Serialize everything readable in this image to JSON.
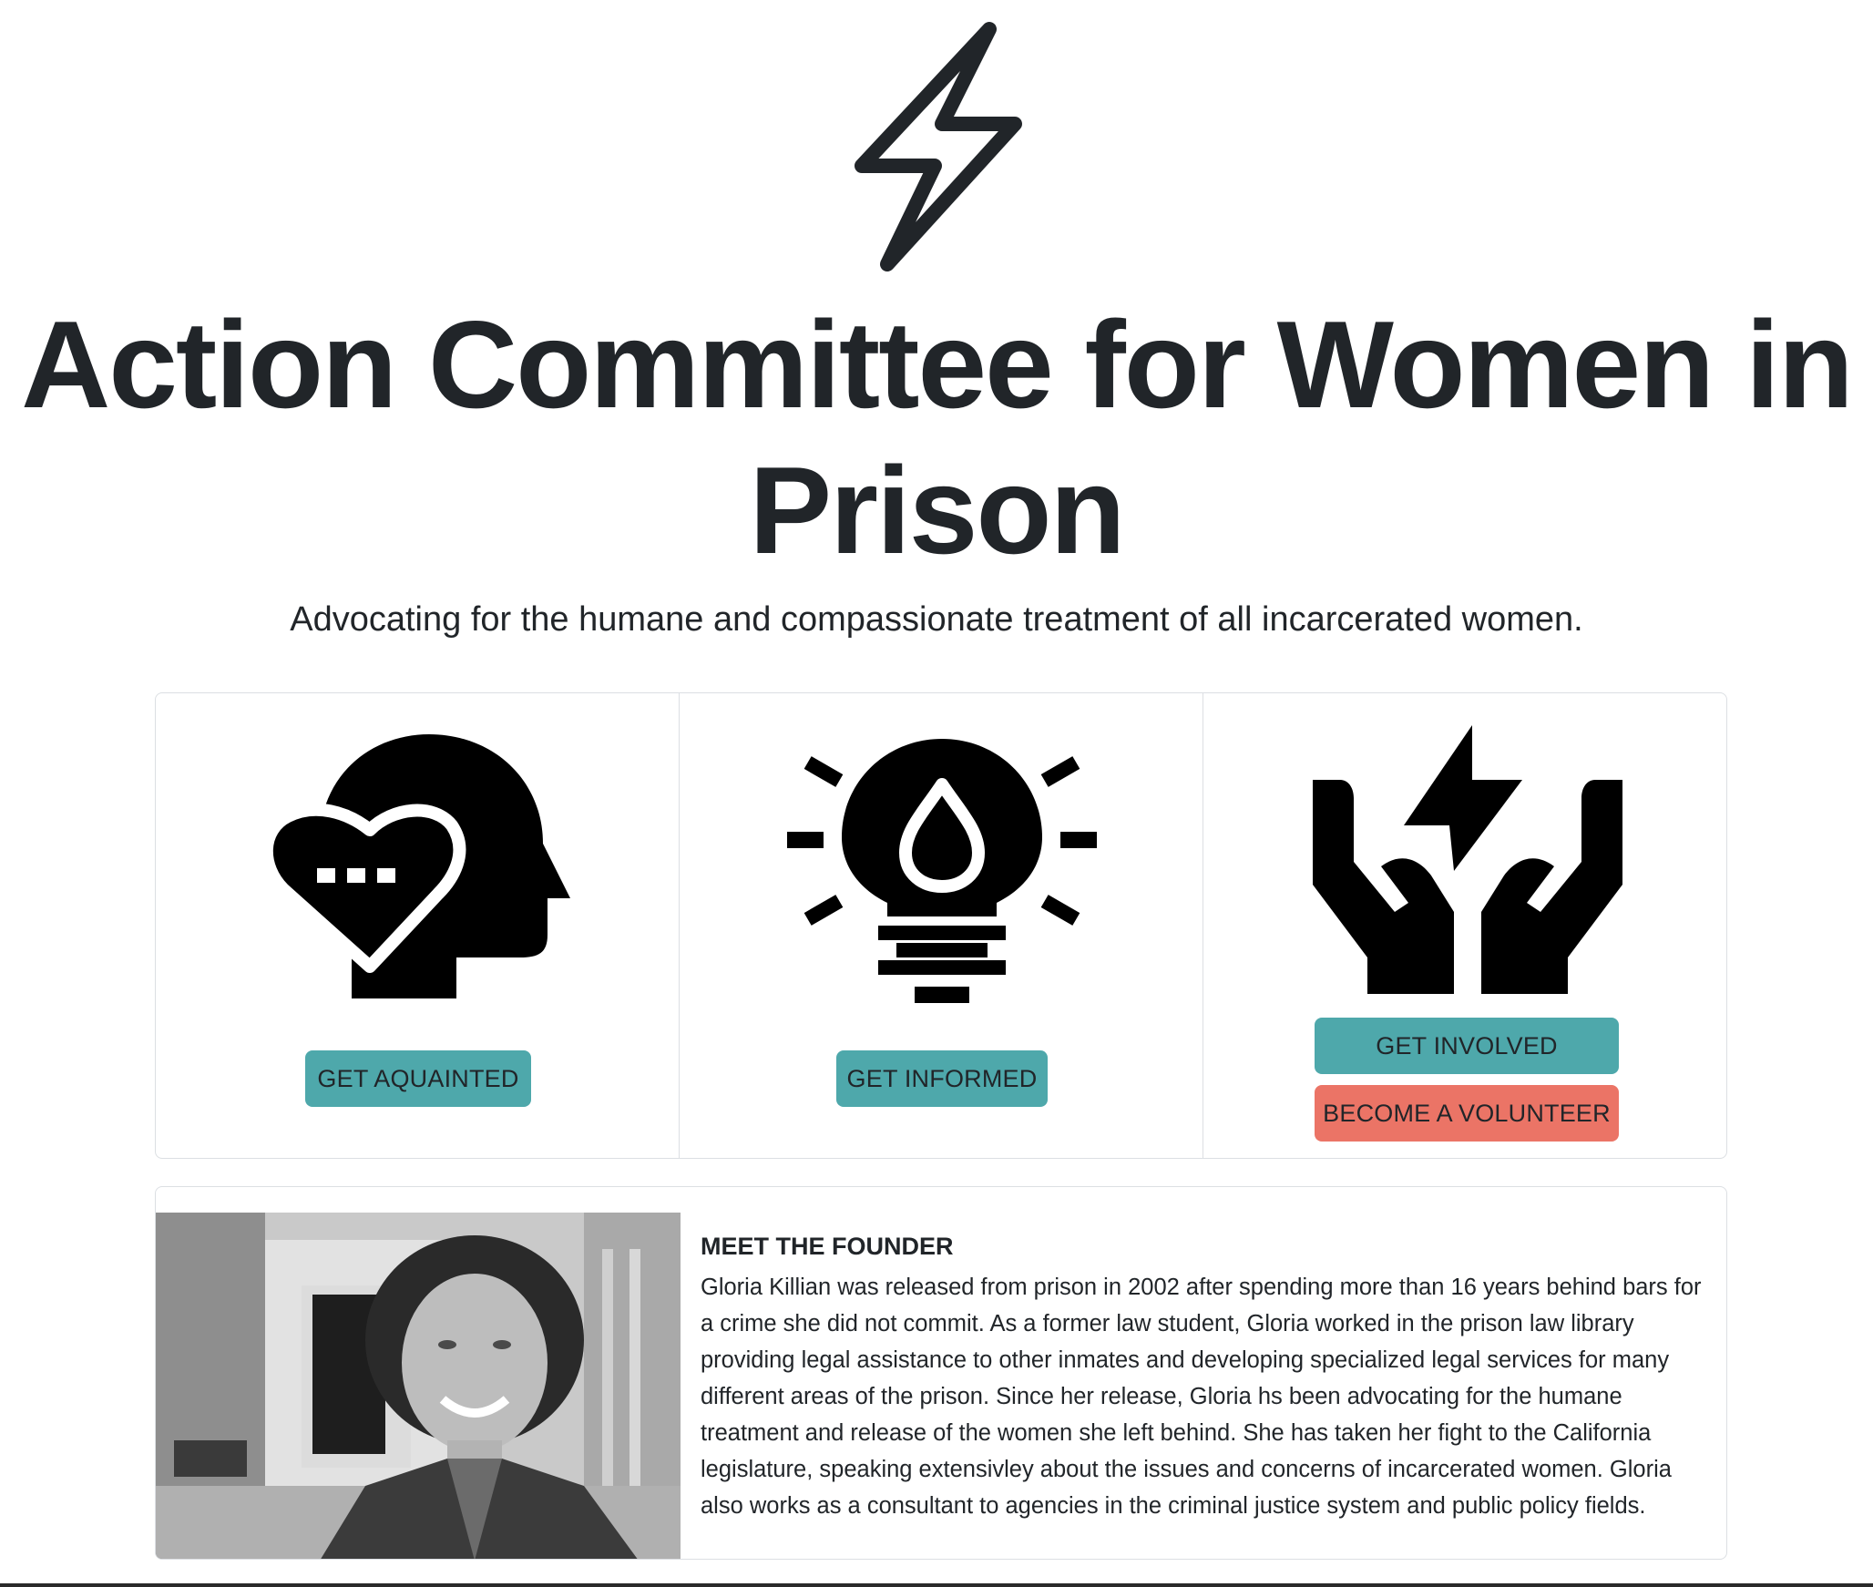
{
  "hero": {
    "logo_icon": "lightning-bolt-icon",
    "title": "Action Committee for Women in Prison",
    "subtitle": "Advocating for the humane and compassionate treatment of all incarcerated women."
  },
  "cards": [
    {
      "icon": "head-heart-icon",
      "buttons": [
        {
          "label": "GET AQUAINTED",
          "color": "#4ea8ab"
        }
      ]
    },
    {
      "icon": "lightbulb-drop-icon",
      "buttons": [
        {
          "label": "GET INFORMED",
          "color": "#4ea8ab"
        }
      ]
    },
    {
      "icon": "hands-lightning-icon",
      "buttons": [
        {
          "label": "GET INVOLVED",
          "color": "#4ea8ab"
        },
        {
          "label": "BECOME A VOLUNTEER",
          "color": "#eb7466"
        }
      ]
    }
  ],
  "founder": {
    "photo": "founder-portrait-photo",
    "heading": "MEET THE FOUNDER",
    "text": "Gloria Killian was released from prison in 2002 after spending more than 16 years behind bars for a crime she did not commit. As a former law student, Gloria worked in the prison law library providing legal assistance to other inmates and developing specialized legal services for many different areas of the prison. Since her release, Gloria hs been advocating for the humane treatment and release of the women she left behind. She has taken her fight to the California legislature, speaking extensivley about the issues and concerns of incarcerated women. Gloria also works as a consultant to agencies in the criminal justice system and public policy fields."
  }
}
